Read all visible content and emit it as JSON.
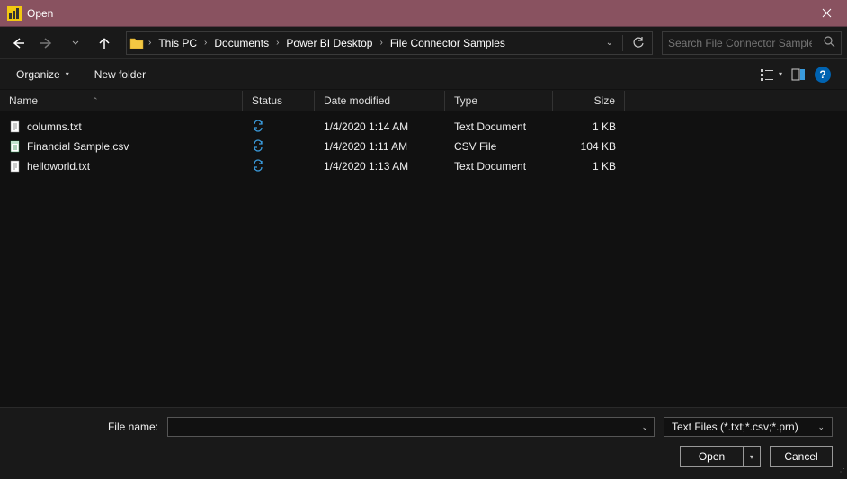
{
  "window": {
    "title": "Open"
  },
  "nav": {
    "breadcrumb": [
      "This PC",
      "Documents",
      "Power BI Desktop",
      "File Connector Samples"
    ],
    "search_placeholder": "Search File Connector Samples"
  },
  "toolbar": {
    "organize": "Organize",
    "new_folder": "New folder"
  },
  "columns": {
    "name": "Name",
    "status": "Status",
    "date": "Date modified",
    "type": "Type",
    "size": "Size"
  },
  "files": [
    {
      "name": "columns.txt",
      "icon": "txt",
      "date": "1/4/2020 1:14 AM",
      "type": "Text Document",
      "size": "1 KB"
    },
    {
      "name": "Financial Sample.csv",
      "icon": "csv",
      "date": "1/4/2020 1:11 AM",
      "type": "CSV File",
      "size": "104 KB"
    },
    {
      "name": "helloworld.txt",
      "icon": "txt",
      "date": "1/4/2020 1:13 AM",
      "type": "Text Document",
      "size": "1 KB"
    }
  ],
  "footer": {
    "filename_label": "File name:",
    "filename_value": "",
    "filter": "Text Files (*.txt;*.csv;*.prn)",
    "open": "Open",
    "cancel": "Cancel"
  }
}
